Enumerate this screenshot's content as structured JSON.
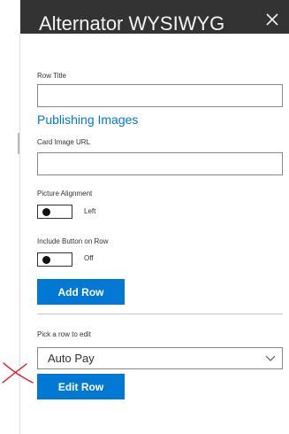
{
  "panel": {
    "title": "Alternator WYSIWYG"
  },
  "form": {
    "row_title_label": "Row Title",
    "row_title_value": "",
    "publishing_images_heading": "Publishing Images",
    "card_image_url_label": "Card Image URL",
    "card_image_url_value": "",
    "picture_alignment_label": "Picture Alignment",
    "picture_alignment_state": "Left",
    "include_button_label": "Include Button on Row",
    "include_button_state": "Off",
    "add_row_label": "Add Row"
  },
  "edit": {
    "pick_row_label": "Pick a row to edit",
    "selected_row": "Auto Pay",
    "edit_row_label": "Edit Row"
  },
  "colors": {
    "header_bg": "#333333",
    "accent": "#0078d4",
    "annotation_mark": "#e81123"
  }
}
